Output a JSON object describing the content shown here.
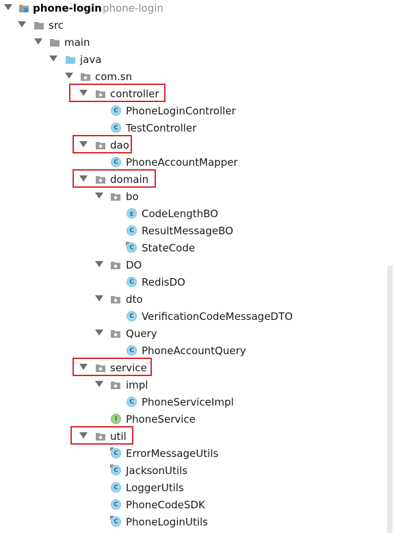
{
  "project": {
    "name": "phone-login",
    "module_hint": "phone-login"
  },
  "tree": {
    "src": "src",
    "main": "main",
    "java": "java",
    "package": "com.sn",
    "controller": {
      "label": "controller",
      "items": [
        "PhoneLoginController",
        "TestController"
      ]
    },
    "dao": {
      "label": "dao",
      "items": [
        "PhoneAccountMapper"
      ]
    },
    "domain": {
      "label": "domain",
      "bo": {
        "label": "bo",
        "items": [
          "CodeLengthBO",
          "ResultMessageBO",
          "StateCode"
        ]
      },
      "do": {
        "label": "DO",
        "items": [
          "RedisDO"
        ]
      },
      "dto": {
        "label": "dto",
        "items": [
          "VerificationCodeMessageDTO"
        ]
      },
      "query": {
        "label": "Query",
        "items": [
          "PhoneAccountQuery"
        ]
      }
    },
    "service": {
      "label": "service",
      "impl": {
        "label": "impl",
        "items": [
          "PhoneServiceImpl"
        ]
      },
      "items": [
        "PhoneService"
      ]
    },
    "util": {
      "label": "util",
      "items": [
        "ErrorMessageUtils",
        "JacksonUtils",
        "LoggerUtils",
        "PhoneCodeSDK",
        "PhoneLoginUtils"
      ]
    }
  },
  "badges": {
    "class": "C",
    "enum": "E",
    "interface": "I"
  },
  "colors": {
    "highlight": "#d9262c",
    "folder": "#9a9a9a",
    "source_folder": "#7ec8e8",
    "class_badge": "#9fd5ee",
    "interface_badge": "#9fd28a"
  }
}
